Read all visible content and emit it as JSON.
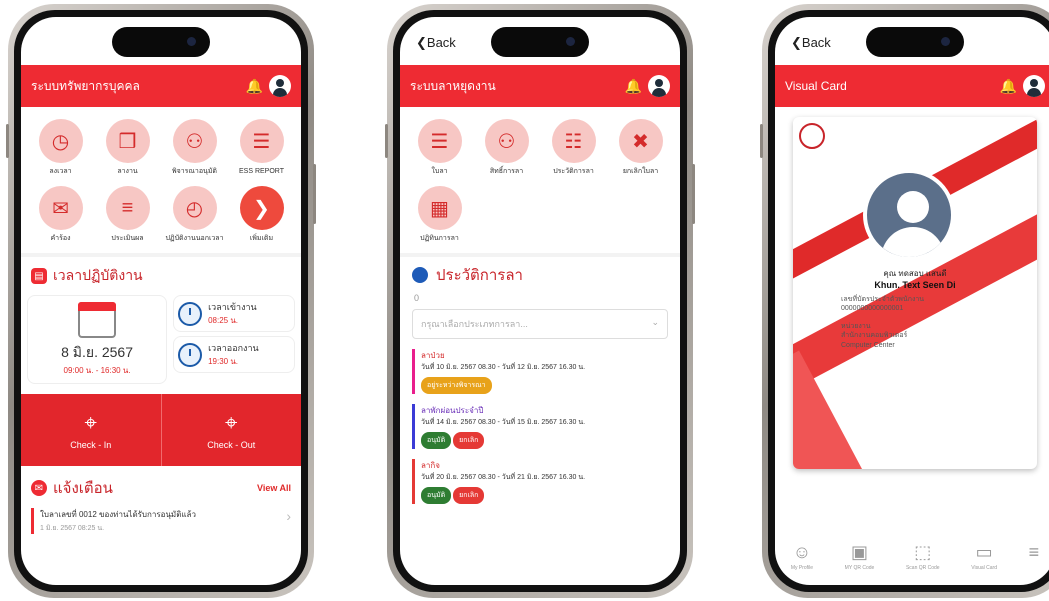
{
  "phone1": {
    "header_title": "ระบบทรัพยากรบุคคล",
    "menu": [
      {
        "label": "ลงเวลา",
        "icon": "clock-icon"
      },
      {
        "label": "ลางาน",
        "icon": "briefcase-icon"
      },
      {
        "label": "พิจารณาอนุมัติ",
        "icon": "team-icon"
      },
      {
        "label": "ESS REPORT",
        "icon": "report-icon"
      },
      {
        "label": "คำร้อง",
        "icon": "request-icon"
      },
      {
        "label": "ประเมินผล",
        "icon": "chart-icon"
      },
      {
        "label": "ปฏิบัติงานนอกเวลา",
        "icon": "overtime-icon"
      },
      {
        "label": "เพิ่มเติม",
        "icon": "arrow-right-icon"
      }
    ],
    "work_section_title": "เวลาปฏิบัติงาน",
    "date": "8 มิ.ย. 2567",
    "work_hours": "09:00 น. - 16:30 น.",
    "checkin_label": "เวลาเข้างาน",
    "checkin_time": "08:25 น.",
    "checkout_label": "เวลาออกงาน",
    "checkout_time": "19:30 น.",
    "check_in": "Check - In",
    "check_out": "Check - Out",
    "notify_title": "แจ้งเตือน",
    "view_all": "View All",
    "notify_item": "ใบลาเลขที่ 0012 ของท่านได้รับการอนุมัติแล้ว",
    "notify_date": "1 มิ.ย. 2567 08:25 น."
  },
  "phone2": {
    "back": "Back",
    "header_title": "ระบบลาหยุดงาน",
    "menu": [
      {
        "label": "ใบลา",
        "icon": "form-icon"
      },
      {
        "label": "สิทธิ์การลา",
        "icon": "people-icon"
      },
      {
        "label": "ประวัติการลา",
        "icon": "list-icon"
      },
      {
        "label": "ยกเลิกใบลา",
        "icon": "cancel-doc-icon"
      },
      {
        "label": "ปฏิทินการลา",
        "icon": "calendar-icon"
      }
    ],
    "history_title": "ประวัติการลา",
    "count": "0",
    "select_placeholder": "กรุณาเลือกประเภทการลา...",
    "leaves": [
      {
        "type": "ลาป่วย",
        "range": "วันที่ 10 มิ.ย. 2567 08.30 - วันที่ 12 มิ.ย. 2567 16.30 น.",
        "color": "#e91e8c",
        "type_color": "#d42b2b",
        "chips": [
          {
            "label": "อยู่ระหว่างพิจารณา",
            "color": "#e8a21a"
          }
        ]
      },
      {
        "type": "ลาพักผ่อนประจำปี",
        "range": "วันที่ 14 มิ.ย. 2567 08.30 - วันที่ 15 มิ.ย. 2567 16.30 น.",
        "color": "#3b3bd6",
        "type_color": "#6a2fb8",
        "chips": [
          {
            "label": "อนุมัติ",
            "color": "#2e7d32"
          },
          {
            "label": "ยกเลิก",
            "color": "#e53935"
          }
        ]
      },
      {
        "type": "ลากิจ",
        "range": "วันที่ 20 มิ.ย. 2567 08.30 - วันที่ 21 มิ.ย. 2567 16.30 น.",
        "color": "#e53935",
        "type_color": "#d42b2b",
        "chips": [
          {
            "label": "อนุมัติ",
            "color": "#2e7d32"
          },
          {
            "label": "ยกเลิก",
            "color": "#e53935"
          }
        ]
      }
    ]
  },
  "phone3": {
    "back": "Back",
    "header_title": "Visual Card",
    "name_th": "คุณ ทดสอบ แสนดี",
    "name_en": "Khun. Text Seen Di",
    "id_label": "เลขที่บัตรประจำตัวพนักงาน",
    "id_value": "0000000000000001",
    "dept_label": "หน่วยงาน",
    "dept_th": "สำนักงานคอมพิวเตอร์",
    "dept_en": "Computer Center",
    "tabs": [
      {
        "label": "My Profile",
        "icon": "user-icon"
      },
      {
        "label": "MY QR Code",
        "icon": "qr-hand-icon"
      },
      {
        "label": "Scan QR Code",
        "icon": "scan-icon"
      },
      {
        "label": "Visual Card",
        "icon": "id-card-icon"
      },
      {
        "label": "",
        "icon": "menu-icon"
      }
    ]
  }
}
